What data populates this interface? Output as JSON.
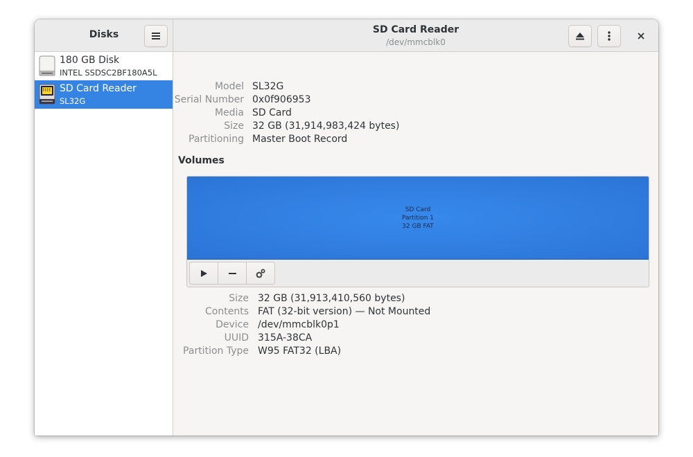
{
  "sidebar": {
    "title": "Disks",
    "items": [
      {
        "name": "180 GB Disk",
        "subtitle": "INTEL SSDSC2BF180A5L",
        "icon": "hard-disk-icon",
        "selected": false
      },
      {
        "name": "SD Card Reader",
        "subtitle": "SL32G",
        "icon": "sd-card-icon",
        "selected": true
      }
    ]
  },
  "header": {
    "title": "SD Card Reader",
    "subtitle": "/dev/mmcblk0"
  },
  "disk_properties": [
    {
      "label": "Model",
      "value": "SL32G"
    },
    {
      "label": "Serial Number",
      "value": "0x0f906953"
    },
    {
      "label": "Media",
      "value": "SD Card"
    },
    {
      "label": "Size",
      "value": "32 GB (31,914,983,424 bytes)"
    },
    {
      "label": "Partitioning",
      "value": "Master Boot Record"
    }
  ],
  "volumes": {
    "heading": "Volumes",
    "partition": {
      "line1": "SD Card",
      "line2": "Partition 1",
      "line3": "32 GB FAT"
    },
    "properties": [
      {
        "label": "Size",
        "value": "32 GB (31,913,410,560 bytes)"
      },
      {
        "label": "Contents",
        "value": "FAT (32-bit version) — Not Mounted"
      },
      {
        "label": "Device",
        "value": "/dev/mmcblk0p1"
      },
      {
        "label": "UUID",
        "value": "315A-38CA"
      },
      {
        "label": "Partition Type",
        "value": "W95 FAT32 (LBA)"
      }
    ]
  },
  "colors": {
    "accent": "#3584e4",
    "partition": "#2f7be0"
  }
}
